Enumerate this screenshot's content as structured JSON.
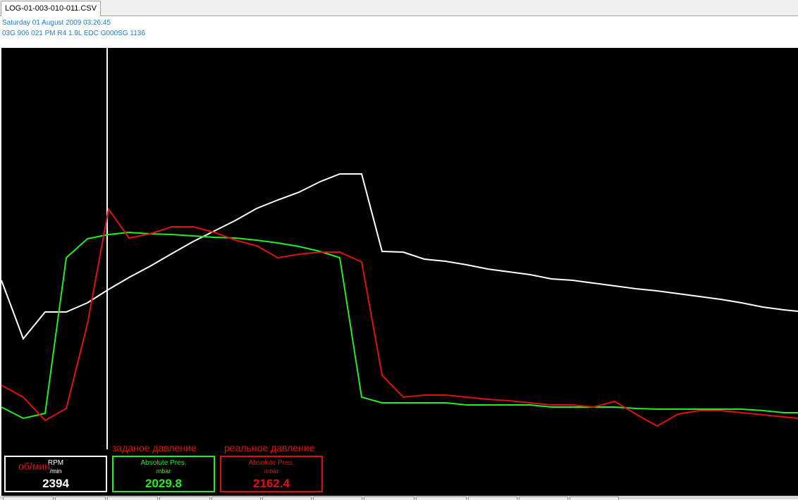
{
  "tab": {
    "label": "LOG-01-003-010-011.CSV"
  },
  "header": {
    "datetime": "Saturday 01 August 2009 03:26:45",
    "ecu": "03G 906 021 PM  R4 1.9L EDC G000SG  1136"
  },
  "colors": {
    "white": "#ffffff",
    "green": "#22ee22",
    "red": "#e01010",
    "background": "#000000"
  },
  "captions": {
    "rpm": "об/мин",
    "specified_pressure": "заданое давление",
    "actual_pressure": "реальное давление"
  },
  "gauges": [
    {
      "label": "RPM",
      "unit": "/min",
      "value": "2394",
      "color": "#ffffff"
    },
    {
      "label": "Absolute Pres.",
      "unit": "mbar",
      "value": "2029.8",
      "color": "#22ee22"
    },
    {
      "label": "Absolute Pres.",
      "unit": "mbar",
      "value": "2162.4",
      "color": "#e01010"
    }
  ]
}
